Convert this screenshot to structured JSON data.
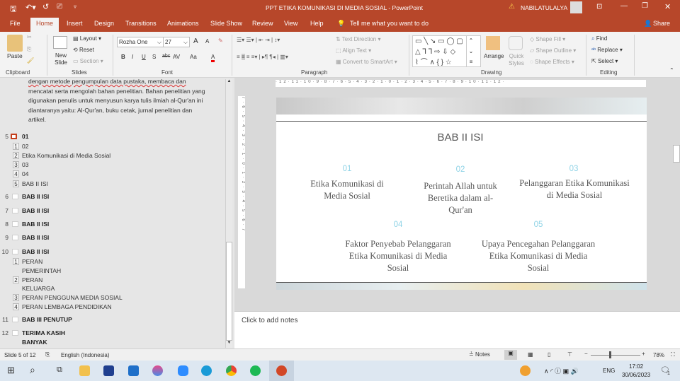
{
  "titlebar": {
    "title": "PPT ETIKA KOMUNIKASI DI MEDIA SOSIAL  -  PowerPoint",
    "user": "NABILATULALYA",
    "warning_icon": "warning-icon"
  },
  "tabs": [
    "File",
    "Home",
    "Insert",
    "Design",
    "Transitions",
    "Animations",
    "Slide Show",
    "Review",
    "View",
    "Help"
  ],
  "tell_me": "Tell me what you want to do",
  "share": "Share",
  "ribbon": {
    "clipboard": {
      "paste": "Paste",
      "label": "Clipboard"
    },
    "slides": {
      "new_slide": "New Slide",
      "layout": "Layout",
      "reset": "Reset",
      "section": "Section",
      "label": "Slides"
    },
    "font": {
      "name": "Rozha One",
      "size": "27",
      "bold": "B",
      "italic": "I",
      "underline": "U",
      "shadow": "S",
      "strike": "abc",
      "spacing": "AV",
      "case": "Aa",
      "color": "A",
      "grow": "A",
      "shrink": "A",
      "label": "Font"
    },
    "paragraph": {
      "text_direction": "Text Direction",
      "align_text": "Align Text",
      "smartart": "Convert to SmartArt",
      "label": "Paragraph"
    },
    "drawing": {
      "arrange": "Arrange",
      "quick_styles": "Quick Styles",
      "shape_fill": "Shape Fill",
      "shape_outline": "Shape Outline",
      "shape_effects": "Shape Effects",
      "label": "Drawing"
    },
    "editing": {
      "find": "Find",
      "replace": "Replace",
      "select": "Select",
      "label": "Editing"
    }
  },
  "outline": {
    "para_lines": [
      "dengan metode pengumpulan data pustaka, membaca dan",
      "mencatat serta mengolah bahan penelitian. Bahan penelitian yang",
      "digunakan penulis untuk menyusun karya tulis ilmiah al-Qur'an ini",
      "diantaranya yaitu: Al-Qur'an, buku cetak, jurnal penelitian dan",
      "artikel."
    ],
    "slides": [
      {
        "num": "5",
        "title": "01",
        "items": [
          [
            "1",
            "02"
          ],
          [
            "2",
            "Etika Komunikasi di Media Sosial"
          ],
          [
            "3",
            "03"
          ],
          [
            "4",
            "04"
          ],
          [
            "5",
            "BAB II ISI"
          ]
        ]
      },
      {
        "num": "6",
        "title": "BAB II ISI"
      },
      {
        "num": "7",
        "title": "BAB II ISI"
      },
      {
        "num": "8",
        "title": "BAB II ISI"
      },
      {
        "num": "9",
        "title": "BAB II ISI"
      },
      {
        "num": "10",
        "title": "BAB II ISI",
        "items": [
          [
            "1",
            "PERAN",
            "PEMERINTAH"
          ],
          [
            "2",
            "PERAN",
            "KELUARGA"
          ],
          [
            "3",
            "PERAN PENGGUNA MEDIA SOSIAL"
          ],
          [
            "4",
            "PERAN LEMBAGA PENDIDIKAN"
          ]
        ]
      },
      {
        "num": "11",
        "title": "BAB III PENUTUP"
      },
      {
        "num": "12",
        "title": "TERIMA KASIH",
        "title2": "BANYAK"
      }
    ]
  },
  "slide": {
    "title": "BAB II ISI",
    "items": [
      {
        "n": "01",
        "text": "Etika Komunikasi di Media Sosial"
      },
      {
        "n": "02",
        "text": "Perintah Allah untuk Beretika dalam al-Qur'an"
      },
      {
        "n": "03",
        "text": "Pelanggaran Etika Komunikasi di Media Sosial"
      },
      {
        "n": "04",
        "text": "Faktor Penyebab Pelanggaran Etika Komunikasi di Media Sosial"
      },
      {
        "n": "05",
        "text": "Upaya Pencegahan Pelanggaran Etika Komunikasi di Media Sosial"
      }
    ]
  },
  "notes_placeholder": "Click to add notes",
  "status": {
    "slide": "Slide 5 of 12",
    "language": "English (Indonesia)",
    "notes": "Notes",
    "zoom": "78%"
  },
  "taskbar": {
    "lang": "ENG",
    "time": "17:02",
    "date": "30/06/2023",
    "notif": "1"
  },
  "colors": {
    "accent": "#b7472a",
    "slide_number": "#8fd3e6"
  }
}
